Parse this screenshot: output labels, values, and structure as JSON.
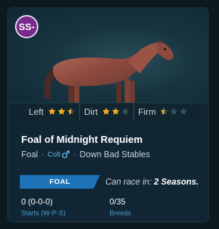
{
  "card": {
    "grade": "SS-",
    "ratings": [
      {
        "label": "Left",
        "stars": 2.5
      },
      {
        "label": "Dirt",
        "stars": 2
      },
      {
        "label": "Firm",
        "stars": 0.5
      }
    ],
    "name": "Foal of Midnight Requiem",
    "life_stage": "Foal",
    "sex": "Colt",
    "stable": "Down Bad Stables",
    "age_badge": "FOAL",
    "race_prefix": "Can race in:",
    "race_value": "2 Seasons.",
    "starts_value": "0 (0-0-0)",
    "starts_label": "Starts (W-P-S)",
    "breeds_value": "0/35",
    "breeds_label": "Breeds"
  },
  "colors": {
    "star_filled": "#f2b01e",
    "star_empty": "#35525c",
    "grade_badge": "#7a2a8c",
    "age_badge": "#1e72b6"
  },
  "icons": {
    "sex": "male-symbol-icon",
    "rating": "star-icon"
  }
}
